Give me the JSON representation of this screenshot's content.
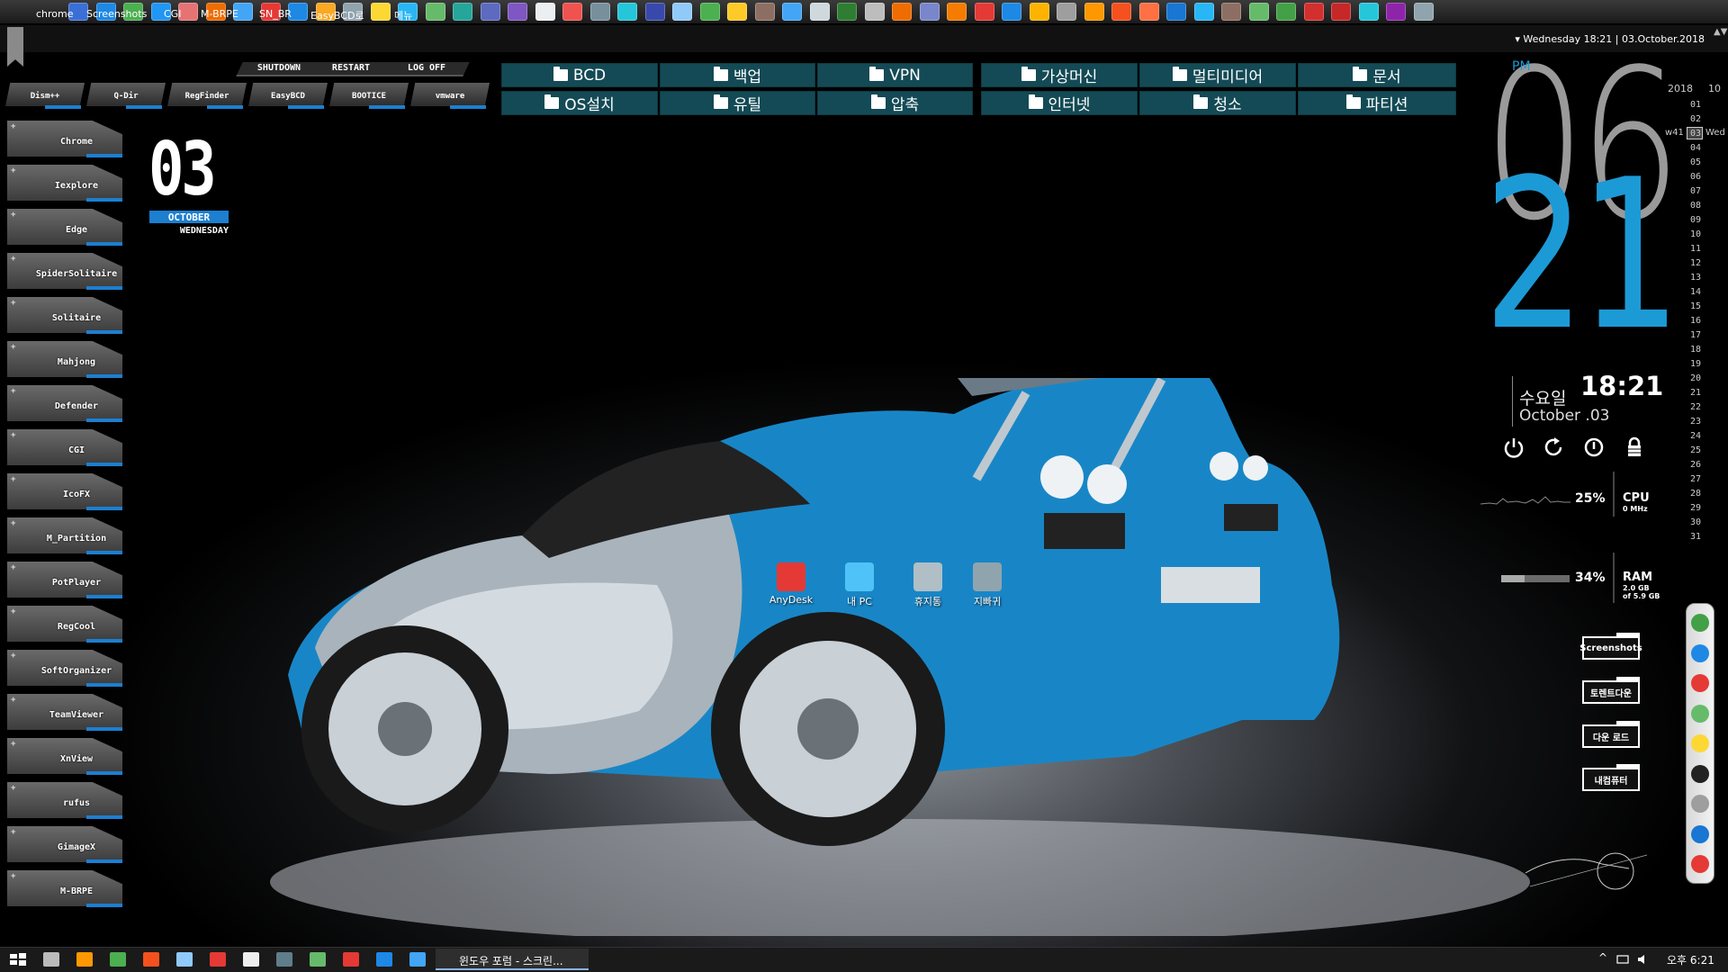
{
  "launcher": {
    "colors": [
      "#3a6fd6",
      "#1e88e5",
      "#4caf50",
      "#2196f3",
      "#e57373",
      "#ef6c00",
      "#42a5f5",
      "#e53935",
      "#1e88e5",
      "#f9a825",
      "#90a4ae",
      "#fdd835",
      "#29b6f6",
      "#66bb6a",
      "#26a69a",
      "#5c6bc0",
      "#7e57c2",
      "#eceff1",
      "#ef5350",
      "#78909c",
      "#26c6da",
      "#3949ab",
      "#90caf9",
      "#4caf50",
      "#ffca28",
      "#8d6e63",
      "#42a5f5",
      "#cfd8dc",
      "#2e7d32",
      "#bdbdbd",
      "#ef6c00",
      "#7986cb",
      "#f57c00",
      "#e53935",
      "#1e88e5",
      "#ffb300",
      "#9e9e9e",
      "#ff9800",
      "#f4511e",
      "#ff7043",
      "#1976d2",
      "#29b6f6",
      "#8d6e63",
      "#66bb6a",
      "#43a047",
      "#d32f2f",
      "#c62828",
      "#26c6da",
      "#8e24aa",
      "#90a4ae"
    ]
  },
  "menu_bar": {
    "items": [
      "chrome",
      "Screenshots",
      "CGI",
      "M-BRPE",
      "SN_BR",
      "EasyBCD로",
      "메뉴"
    ],
    "clock": "▾ Wednesday 18:21 | 03.October.2018",
    "scroll": "▲▼"
  },
  "power": {
    "shutdown": "SHUTDOWN",
    "restart": "RESTART",
    "logoff": "LOG OFF"
  },
  "sub_tabs": [
    "Dism++",
    "Q-Dir",
    "RegFinder",
    "EasyBCD",
    "BOOTICE",
    "vmware"
  ],
  "tiles": [
    "Chrome",
    "Iexplore",
    "Edge",
    "SpiderSolitaire",
    "Solitaire",
    "Mahjong",
    "Defender",
    "CGI",
    "IcoFX",
    "M_Partition",
    "PotPlayer",
    "RegCool",
    "SoftOrganizer",
    "TeamViewer",
    "XnView",
    "rufus",
    "GimageX",
    "M-BRPE"
  ],
  "tile_plus": "+",
  "date_widget": {
    "day": "03",
    "month": "OCTOBER",
    "weekday": "WEDNESDAY"
  },
  "folders": {
    "row1": [
      "BCD",
      "백업",
      "VPN",
      "가상머신",
      "멀티미디어",
      "문서"
    ],
    "row2": [
      "OS설치",
      "유틸",
      "압축",
      "인터넷",
      "청소",
      "파티션"
    ]
  },
  "clock": {
    "ampm": "PM",
    "hour": "06",
    "minute": "21",
    "korean_day": "수요일",
    "time": "18:21",
    "date": "October .03",
    "accent": "#1c9ad6"
  },
  "calendar": {
    "year": "2018",
    "month": "10",
    "week": "w41",
    "weekday": "Wed",
    "days": [
      "01",
      "02",
      "03",
      "04",
      "05",
      "06",
      "07",
      "08",
      "09",
      "10",
      "11",
      "12",
      "13",
      "14",
      "15",
      "16",
      "17",
      "18",
      "19",
      "20",
      "21",
      "22",
      "23",
      "24",
      "25",
      "26",
      "27",
      "28",
      "29",
      "30",
      "31"
    ]
  },
  "system": {
    "cpu_pct": "25%",
    "cpu_label": "CPU",
    "cpu_freq": "0 MHz",
    "ram_pct": "34%",
    "ram_label": "RAM",
    "ram_used": "2.0 GB",
    "ram_total": "of 5.9 GB",
    "ram_fraction": 0.34
  },
  "quick_buttons": [
    "Screenshots",
    "토렌트다운",
    "다운 로드",
    "내컴퓨터"
  ],
  "desktop_icons": [
    "AnyDesk",
    "내 PC",
    "휴지통",
    "지빠귀"
  ],
  "taskbar": {
    "window_label": "윈도우 포럼 - 스크린...",
    "tray_arrow": "^",
    "clock": "오후 6:21"
  }
}
